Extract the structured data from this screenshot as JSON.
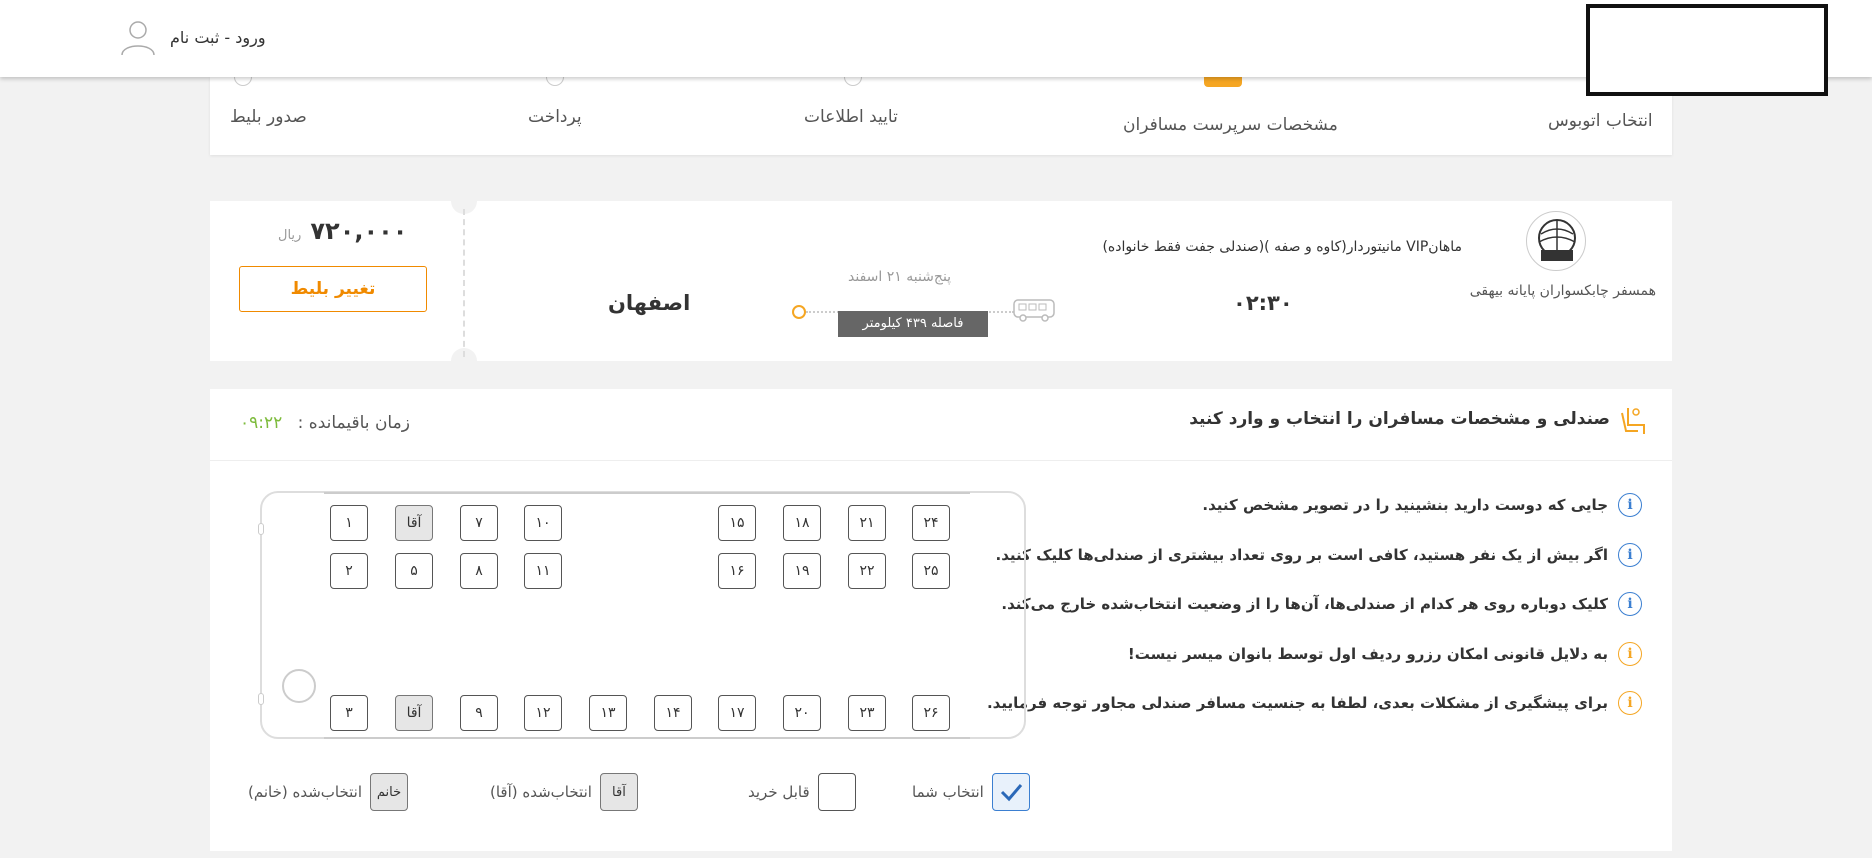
{
  "header": {
    "login_label": "ورود - ثبت نام"
  },
  "steps": [
    {
      "label": "انتخاب اتوبوس",
      "state": "done"
    },
    {
      "label": "مشخصات سرپرست مسافران",
      "state": "active"
    },
    {
      "label": "تایید اطلاعات",
      "state": "pending"
    },
    {
      "label": "پرداخت",
      "state": "pending"
    },
    {
      "label": "صدور بلیط",
      "state": "pending"
    }
  ],
  "trip": {
    "company": "همسفر چابکسواران پایانه بیهقی",
    "company_logo_text": "همسفر",
    "bus_description": "ماهانVIP مانیتوردار(کاوه و صفه )(صندلی جفت فقط خانواده)",
    "departure_time": "۰۲:۳۰",
    "date": "پنج‌شنبه ۲۱ اسفند",
    "distance": "فاصله ۴۳۹ کیلومتر",
    "destination": "اصفهان",
    "price": "۷۲۰,۰۰۰",
    "price_unit": "ریال",
    "change_button": "تغییر بلیط"
  },
  "seat_panel": {
    "title": "صندلی و مشخصات مسافران را انتخاب و وارد کنید",
    "timer_label": "زمان باقیمانده :",
    "timer_value": "۰۹:۲۲",
    "infos": [
      {
        "text": "جایی که دوست دارید بنشینید را در تصویر مشخص کنید.",
        "color": "blue"
      },
      {
        "text": "اگر بیش از یک نفر هستید، کافی است بر روی تعداد بیشتری از صندلی‌ها کلیک کنید.",
        "color": "blue"
      },
      {
        "text": "کلیک دوباره روی هر کدام از صندلی‌ها، آن‌ها را از وضعیت انتخاب‌شده خارج می‌کند.",
        "color": "blue"
      },
      {
        "text": "به دلایل قانونی امکان رزرو ردیف اول توسط بانوان میسر نیست!",
        "color": "orange"
      },
      {
        "text": "برای پیشگیری از مشکلات بعدی، لطفا به جنسیت مسافر صندلی مجاور توجه فرمایید.",
        "color": "orange"
      }
    ],
    "seats_row1": [
      "۱",
      "آقا",
      "۷",
      "۱۰",
      "۱۵",
      "۱۸",
      "۲۱",
      "۲۴"
    ],
    "seats_row2": [
      "۲",
      "۵",
      "۸",
      "۱۱",
      "۱۶",
      "۱۹",
      "۲۲",
      "۲۵"
    ],
    "seats_row3": [
      "۳",
      "آقا",
      "۹",
      "۱۲",
      "۱۳",
      "۱۴",
      "۱۷",
      "۲۰",
      "۲۳",
      "۲۶"
    ],
    "legend": {
      "selected": "انتخاب شما",
      "available": "قابل خرید",
      "male": "انتخاب‌شده (آقا)",
      "male_box": "آقا",
      "female": "انتخاب‌شده (خانم)",
      "female_box": "خانم"
    }
  }
}
